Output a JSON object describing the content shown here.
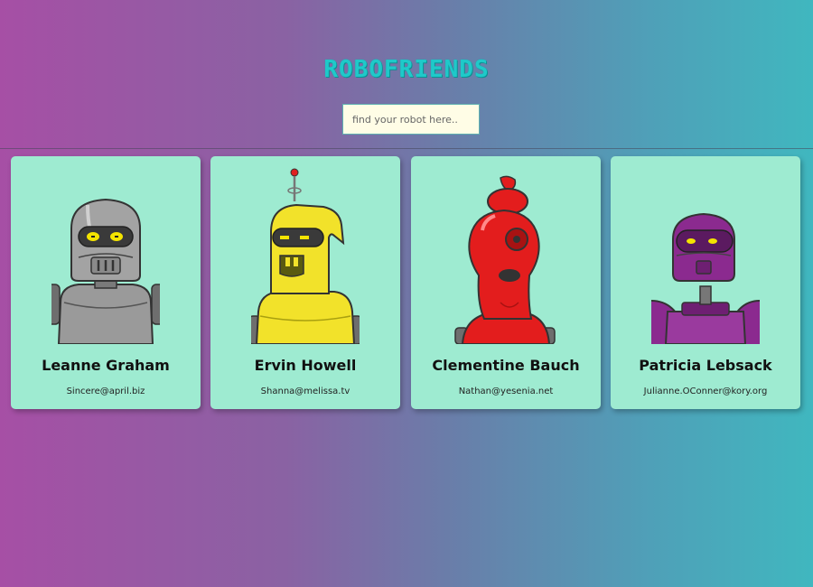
{
  "header": {
    "title": "ROBOFRIENDS"
  },
  "search": {
    "placeholder": "find your robot here..."
  },
  "robots": [
    {
      "name": "Leanne Graham",
      "email": "Sincere@april.biz",
      "color": "#8f8f8f"
    },
    {
      "name": "Ervin Howell",
      "email": "Shanna@melissa.tv",
      "color": "#f2e22a"
    },
    {
      "name": "Clementine Bauch",
      "email": "Nathan@yesenia.net",
      "color": "#e31d1d"
    },
    {
      "name": "Patricia Lebsack",
      "email": "Julianne.OConner@kory.org",
      "color": "#8b2a8f"
    }
  ]
}
